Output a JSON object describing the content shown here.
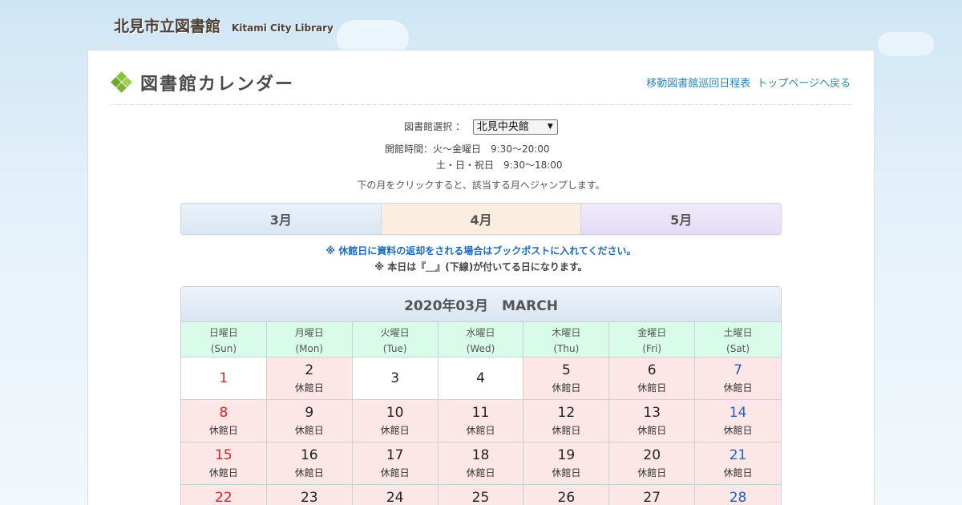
{
  "site": {
    "title": "北見市立図書館",
    "subtitle": "Kitami City Library"
  },
  "page": {
    "title": "図書館カレンダー"
  },
  "header_links": [
    {
      "label": "移動図書館巡回日程表"
    },
    {
      "label": "トップページへ戻る"
    }
  ],
  "library_select": {
    "label": "図書館選択 ：",
    "value": "北見中央館"
  },
  "hours": {
    "line1": "開館時間：火～金曜日　9:30～20:00",
    "line2": "土・日・祝日　9:30～18:00"
  },
  "jump_note": "下の月をクリックすると、該当する月へジャンプします。",
  "month_tabs": [
    {
      "label": "3月"
    },
    {
      "label": "4月"
    },
    {
      "label": "5月"
    }
  ],
  "notices": {
    "line1": "※ 休館日に資料の返却をされる場合はブックポストに入れてください。",
    "line2": "※ 本日は『＿』(下線)が付いてる日になります。"
  },
  "calendar": {
    "title": "2020年03月　MARCH",
    "weekdays": [
      {
        "jp": "日曜日",
        "en": "(Sun)"
      },
      {
        "jp": "月曜日",
        "en": "(Mon)"
      },
      {
        "jp": "火曜日",
        "en": "(Tue)"
      },
      {
        "jp": "水曜日",
        "en": "(Wed)"
      },
      {
        "jp": "木曜日",
        "en": "(Thu)"
      },
      {
        "jp": "金曜日",
        "en": "(Fri)"
      },
      {
        "jp": "土曜日",
        "en": "(Sat)"
      }
    ],
    "closed_label": "休館日",
    "weeks": [
      [
        {
          "day": "1",
          "closed": false
        },
        {
          "day": "2",
          "closed": true
        },
        {
          "day": "3",
          "closed": false
        },
        {
          "day": "4",
          "closed": false
        },
        {
          "day": "5",
          "closed": true
        },
        {
          "day": "6",
          "closed": true
        },
        {
          "day": "7",
          "closed": true
        }
      ],
      [
        {
          "day": "8",
          "closed": true
        },
        {
          "day": "9",
          "closed": true
        },
        {
          "day": "10",
          "closed": true
        },
        {
          "day": "11",
          "closed": true
        },
        {
          "day": "12",
          "closed": true
        },
        {
          "day": "13",
          "closed": true
        },
        {
          "day": "14",
          "closed": true
        }
      ],
      [
        {
          "day": "15",
          "closed": true
        },
        {
          "day": "16",
          "closed": true
        },
        {
          "day": "17",
          "closed": true
        },
        {
          "day": "18",
          "closed": true
        },
        {
          "day": "19",
          "closed": true
        },
        {
          "day": "20",
          "closed": true
        },
        {
          "day": "21",
          "closed": true
        }
      ],
      [
        {
          "day": "22",
          "closed": true
        },
        {
          "day": "23",
          "closed": true
        },
        {
          "day": "24",
          "closed": true
        },
        {
          "day": "25",
          "closed": true
        },
        {
          "day": "26",
          "closed": true
        },
        {
          "day": "27",
          "closed": true
        },
        {
          "day": "28",
          "closed": true
        }
      ]
    ]
  },
  "colors": {
    "closed_bg": "#fde6e6",
    "weekday_header_bg": "#d9fbe9",
    "sunday": "#e02020",
    "saturday": "#2060c0",
    "link": "#2a86c2",
    "notice": "#1a6bbf"
  },
  "icons": {
    "title_icon": "diamond-cluster-icon",
    "select_arrow": "dropdown-arrow-icon"
  }
}
